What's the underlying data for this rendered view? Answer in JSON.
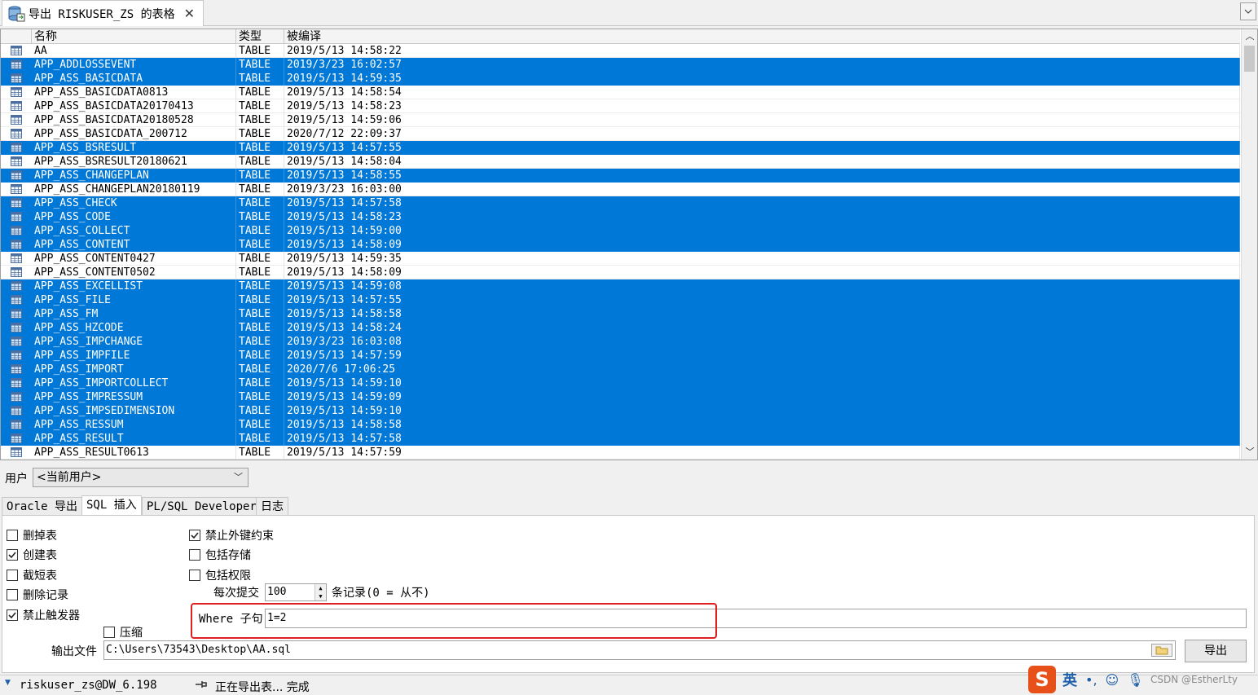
{
  "tab": {
    "title": "导出 RISKUSER_ZS 的表格",
    "close": "✕"
  },
  "grid": {
    "columns": {
      "name": "名称",
      "type": "类型",
      "compiled": "被编译"
    },
    "rows": [
      {
        "name": "AA",
        "type": "TABLE",
        "compiled": "2019/5/13 14:58:22",
        "selected": false
      },
      {
        "name": "APP_ADDLOSSEVENT",
        "type": "TABLE",
        "compiled": "2019/3/23 16:02:57",
        "selected": true
      },
      {
        "name": "APP_ASS_BASICDATA",
        "type": "TABLE",
        "compiled": "2019/5/13 14:59:35",
        "selected": true
      },
      {
        "name": "APP_ASS_BASICDATA0813",
        "type": "TABLE",
        "compiled": "2019/5/13 14:58:54",
        "selected": false
      },
      {
        "name": "APP_ASS_BASICDATA20170413",
        "type": "TABLE",
        "compiled": "2019/5/13 14:58:23",
        "selected": false
      },
      {
        "name": "APP_ASS_BASICDATA20180528",
        "type": "TABLE",
        "compiled": "2019/5/13 14:59:06",
        "selected": false
      },
      {
        "name": "APP_ASS_BASICDATA_200712",
        "type": "TABLE",
        "compiled": "2020/7/12 22:09:37",
        "selected": false
      },
      {
        "name": "APP_ASS_BSRESULT",
        "type": "TABLE",
        "compiled": "2019/5/13 14:57:55",
        "selected": true
      },
      {
        "name": "APP_ASS_BSRESULT20180621",
        "type": "TABLE",
        "compiled": "2019/5/13 14:58:04",
        "selected": false
      },
      {
        "name": "APP_ASS_CHANGEPLAN",
        "type": "TABLE",
        "compiled": "2019/5/13 14:58:55",
        "selected": true
      },
      {
        "name": "APP_ASS_CHANGEPLAN20180119",
        "type": "TABLE",
        "compiled": "2019/3/23 16:03:00",
        "selected": false
      },
      {
        "name": "APP_ASS_CHECK",
        "type": "TABLE",
        "compiled": "2019/5/13 14:57:58",
        "selected": true
      },
      {
        "name": "APP_ASS_CODE",
        "type": "TABLE",
        "compiled": "2019/5/13 14:58:23",
        "selected": true
      },
      {
        "name": "APP_ASS_COLLECT",
        "type": "TABLE",
        "compiled": "2019/5/13 14:59:00",
        "selected": true
      },
      {
        "name": "APP_ASS_CONTENT",
        "type": "TABLE",
        "compiled": "2019/5/13 14:58:09",
        "selected": true
      },
      {
        "name": "APP_ASS_CONTENT0427",
        "type": "TABLE",
        "compiled": "2019/5/13 14:59:35",
        "selected": false
      },
      {
        "name": "APP_ASS_CONTENT0502",
        "type": "TABLE",
        "compiled": "2019/5/13 14:58:09",
        "selected": false
      },
      {
        "name": "APP_ASS_EXCELLIST",
        "type": "TABLE",
        "compiled": "2019/5/13 14:59:08",
        "selected": true
      },
      {
        "name": "APP_ASS_FILE",
        "type": "TABLE",
        "compiled": "2019/5/13 14:57:55",
        "selected": true
      },
      {
        "name": "APP_ASS_FM",
        "type": "TABLE",
        "compiled": "2019/5/13 14:58:58",
        "selected": true
      },
      {
        "name": "APP_ASS_HZCODE",
        "type": "TABLE",
        "compiled": "2019/5/13 14:58:24",
        "selected": true
      },
      {
        "name": "APP_ASS_IMPCHANGE",
        "type": "TABLE",
        "compiled": "2019/3/23 16:03:08",
        "selected": true
      },
      {
        "name": "APP_ASS_IMPFILE",
        "type": "TABLE",
        "compiled": "2019/5/13 14:57:59",
        "selected": true
      },
      {
        "name": "APP_ASS_IMPORT",
        "type": "TABLE",
        "compiled": "2020/7/6 17:06:25",
        "selected": true
      },
      {
        "name": "APP_ASS_IMPORTCOLLECT",
        "type": "TABLE",
        "compiled": "2019/5/13 14:59:10",
        "selected": true
      },
      {
        "name": "APP_ASS_IMPRESSUM",
        "type": "TABLE",
        "compiled": "2019/5/13 14:59:09",
        "selected": true
      },
      {
        "name": "APP_ASS_IMPSEDIMENSION",
        "type": "TABLE",
        "compiled": "2019/5/13 14:59:10",
        "selected": true
      },
      {
        "name": "APP_ASS_RESSUM",
        "type": "TABLE",
        "compiled": "2019/5/13 14:58:58",
        "selected": true
      },
      {
        "name": "APP_ASS_RESULT",
        "type": "TABLE",
        "compiled": "2019/5/13 14:57:58",
        "selected": true
      },
      {
        "name": "APP_ASS_RESULT0613",
        "type": "TABLE",
        "compiled": "2019/5/13 14:57:59",
        "selected": false
      }
    ]
  },
  "user": {
    "label": "用户",
    "selected": "<当前用户>"
  },
  "option_tabs": [
    {
      "label": "Oracle 导出",
      "active": false
    },
    {
      "label": "SQL 插入",
      "active": true
    },
    {
      "label": "PL/SQL Developer",
      "active": false
    },
    {
      "label": "日志",
      "active": false
    }
  ],
  "options": {
    "drop_tables": {
      "label": "删掉表",
      "checked": false
    },
    "create_tables": {
      "label": "创建表",
      "checked": true
    },
    "truncate_tables": {
      "label": "截短表",
      "checked": false
    },
    "delete_records": {
      "label": "删除记录",
      "checked": false
    },
    "disable_triggers": {
      "label": "禁止触发器",
      "checked": true
    },
    "compress": {
      "label": "压缩",
      "checked": false
    },
    "disable_fk": {
      "label": "禁止外键约束",
      "checked": true
    },
    "include_storage": {
      "label": "包括存储",
      "checked": false
    },
    "include_privileges": {
      "label": "包括权限",
      "checked": false
    },
    "commit_label": "每次提交",
    "commit_value": "100",
    "commit_hint": "条记录(0 = 从不)",
    "where_label": "Where 子句",
    "where_value": "1=2",
    "output_label": "输出文件",
    "output_value": "C:\\Users\\73543\\Desktop\\AA.sql",
    "export_button": "导出"
  },
  "status": {
    "connection": "riskuser_zs@DW_6.198",
    "message": "正在导出表... 完成"
  },
  "ime": {
    "logo": "S",
    "lang": "英",
    "watermark": "CSDN @EstherLty"
  }
}
